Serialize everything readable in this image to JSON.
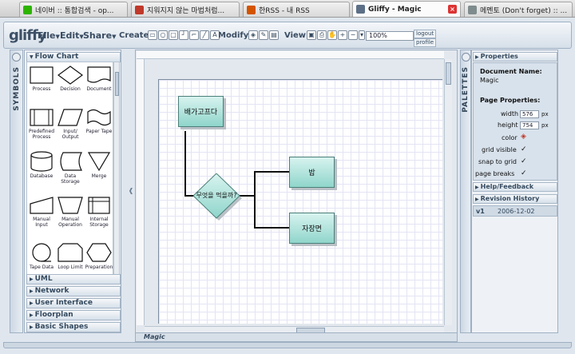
{
  "browser": {
    "tabs": [
      {
        "title": "네이버 :: 통합검색 - op...",
        "favicon_color": "#2db400",
        "active": false
      },
      {
        "title": "지워지지 않는 마법처럼...",
        "favicon_color": "#c0392b",
        "active": false
      },
      {
        "title": "한RSS - 내 RSS",
        "favicon_color": "#d35400",
        "active": false
      },
      {
        "title": "Gliffy - Magic",
        "favicon_color": "#5c6f86",
        "active": true
      },
      {
        "title": "메멘토 (Don't forget) :: ...",
        "favicon_color": "#7f8c8d",
        "active": false
      }
    ]
  },
  "app": {
    "logo": "gliffy",
    "menus": {
      "file": "File",
      "edit": "Edit",
      "share": "Share"
    },
    "create_label": "Create",
    "modify_label": "Modify",
    "view_label": "View",
    "zoom_value": "100%",
    "logout_label": "logout",
    "profile_label": "profile"
  },
  "symbols": {
    "tab_label": "SYMBOLS",
    "open_section": "Flow Chart",
    "items": [
      {
        "icon": "process-shape",
        "label": "Process"
      },
      {
        "icon": "decision-shape",
        "label": "Decision"
      },
      {
        "icon": "document-shape",
        "label": "Document"
      },
      {
        "icon": "predefined-process-shape",
        "label": "Predefined Process"
      },
      {
        "icon": "input-output-shape",
        "label": "Input/ Output"
      },
      {
        "icon": "paper-tape-shape",
        "label": "Paper Tape"
      },
      {
        "icon": "database-shape",
        "label": "Database"
      },
      {
        "icon": "data-storage-shape",
        "label": "Data Storage"
      },
      {
        "icon": "merge-shape",
        "label": "Merge"
      },
      {
        "icon": "manual-input-shape",
        "label": "Manual Input"
      },
      {
        "icon": "manual-operation-shape",
        "label": "Manual Operation"
      },
      {
        "icon": "internal-storage-shape",
        "label": "Internal Storage"
      },
      {
        "icon": "tape-data-shape",
        "label": "Tape Data"
      },
      {
        "icon": "loop-limit-shape",
        "label": "Loop Limit"
      },
      {
        "icon": "preparation-shape",
        "label": "Preparation"
      }
    ],
    "other_sections": [
      "UML",
      "Network",
      "User Interface",
      "Floorplan",
      "Basic Shapes"
    ]
  },
  "canvas": {
    "document_name": "Magic",
    "nodes": {
      "start": "배가고프다",
      "decision": "무엇을 먹을까?",
      "option1": "밥",
      "option2": "자장면"
    }
  },
  "palettes": {
    "tab_label": "PALETTES",
    "properties_label": "Properties",
    "document_name_label": "Document Name:",
    "document_name": "Magic",
    "page_properties_label": "Page Properties:",
    "width_label": "width",
    "width_value": "576",
    "height_label": "height",
    "height_value": "754",
    "unit": "px",
    "color_label": "color",
    "grid_visible_label": "grid visible",
    "snap_to_grid_label": "snap to grid",
    "page_breaks_label": "page breaks",
    "help_label": "Help/Feedback",
    "revision_history_label": "Revision History",
    "revision": {
      "version": "v1",
      "date": "2006-12-02"
    }
  }
}
